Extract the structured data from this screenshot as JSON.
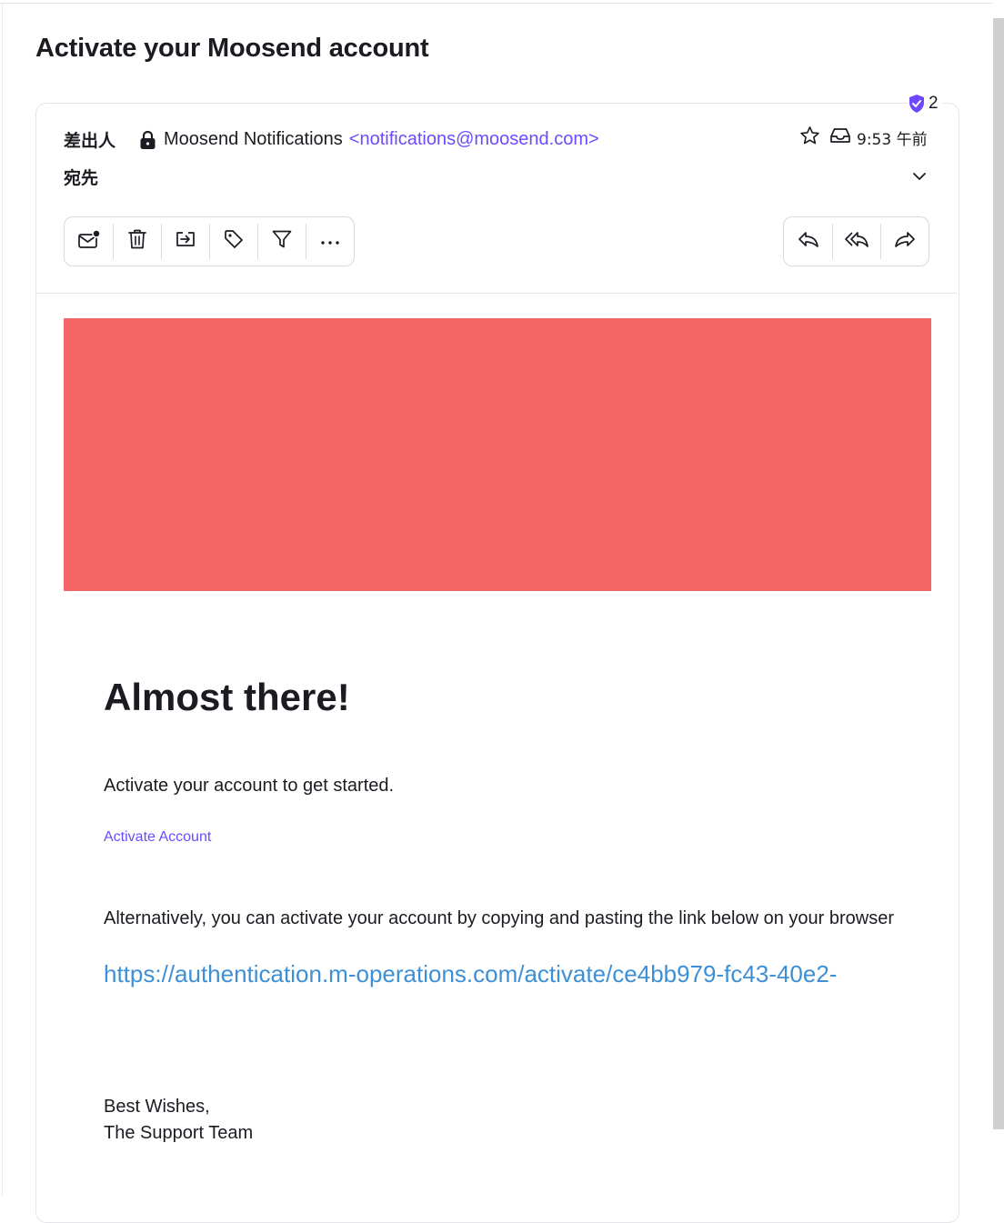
{
  "subject": "Activate your Moosend account",
  "trust_badge": {
    "icon": "shield-check-icon",
    "count": "2",
    "color": "#6d4aff"
  },
  "header": {
    "from_label": "差出人",
    "sender_name": "Moosend Notifications",
    "sender_email": "<notifications@moosend.com>",
    "to_label": "宛先",
    "time": "9:53 午前"
  },
  "toolbar": {
    "left": [
      "mark-unread-icon",
      "trash-icon",
      "move-to-folder-icon",
      "label-tag-icon",
      "filter-icon",
      "more-options-icon"
    ],
    "right": [
      "reply-icon",
      "reply-all-icon",
      "forward-icon"
    ]
  },
  "email": {
    "banner_color": "#f46566",
    "heading": "Almost there!",
    "intro": "Activate your account to get started.",
    "activate_link": "Activate Account",
    "alt_text": "Alternatively, you can activate your account by copying and pasting the link below on your browser",
    "url": "https://authentication.m-operations.com/activate/ce4bb979-fc43-40e2-",
    "signoff": "Best Wishes,",
    "team": "The Support Team"
  },
  "colors": {
    "accent": "#6d4aff",
    "link": "#3d8fd6",
    "text": "#1c1b22"
  }
}
